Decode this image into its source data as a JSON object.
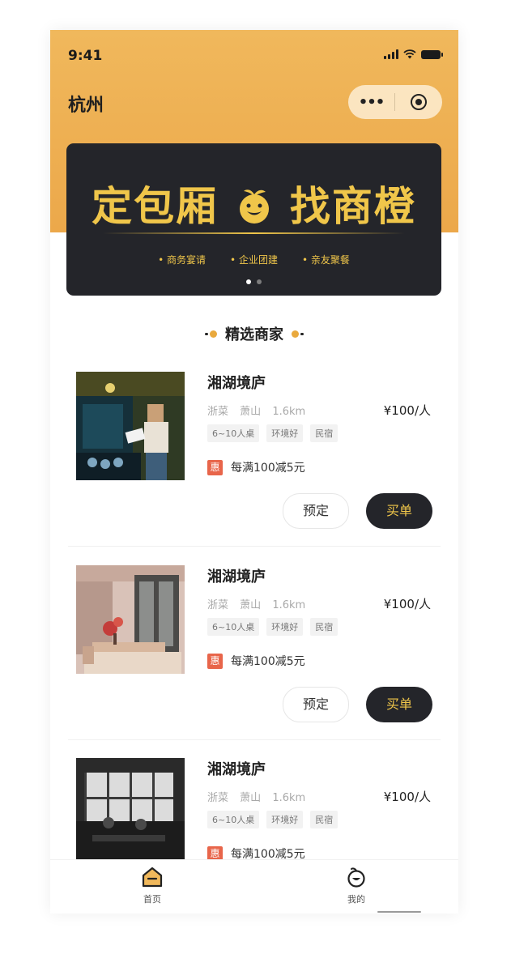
{
  "status": {
    "time": "9:41"
  },
  "header": {
    "city": "杭州",
    "more": "•••"
  },
  "banner": {
    "title_left": "定包厢",
    "title_right": "找商橙",
    "tags": [
      "商务宴请",
      "企业团建",
      "亲友聚餐"
    ],
    "dot_count": 2,
    "active_dot": 0
  },
  "section": {
    "title": "精选商家"
  },
  "merchants": [
    {
      "name": "湘湖境庐",
      "cuisine": "浙菜",
      "area": "萧山",
      "distance": "1.6km",
      "price": "¥100/人",
      "tags": [
        "6~10人桌",
        "环境好",
        "民宿"
      ],
      "promo_badge": "惠",
      "promo_text": "每满100减5元",
      "reserve_label": "预定",
      "pay_label": "买单"
    },
    {
      "name": "湘湖境庐",
      "cuisine": "浙菜",
      "area": "萧山",
      "distance": "1.6km",
      "price": "¥100/人",
      "tags": [
        "6~10人桌",
        "环境好",
        "民宿"
      ],
      "promo_badge": "惠",
      "promo_text": "每满100减5元",
      "reserve_label": "预定",
      "pay_label": "买单"
    },
    {
      "name": "湘湖境庐",
      "cuisine": "浙菜",
      "area": "萧山",
      "distance": "1.6km",
      "price": "¥100/人",
      "tags": [
        "6~10人桌",
        "环境好",
        "民宿"
      ],
      "promo_badge": "惠",
      "promo_text": "每满100减5元"
    }
  ],
  "tabbar": {
    "items": [
      {
        "label": "首页",
        "icon": "home-icon",
        "active": true
      },
      {
        "label": "我的",
        "icon": "orange-face-icon",
        "active": false
      }
    ]
  },
  "colors": {
    "header_gradient_top": "#f0b85c",
    "header_gradient_bottom": "#eca84a",
    "banner_bg": "#24252a",
    "gold": "#f0c64a",
    "promo_red": "#e8654a"
  }
}
